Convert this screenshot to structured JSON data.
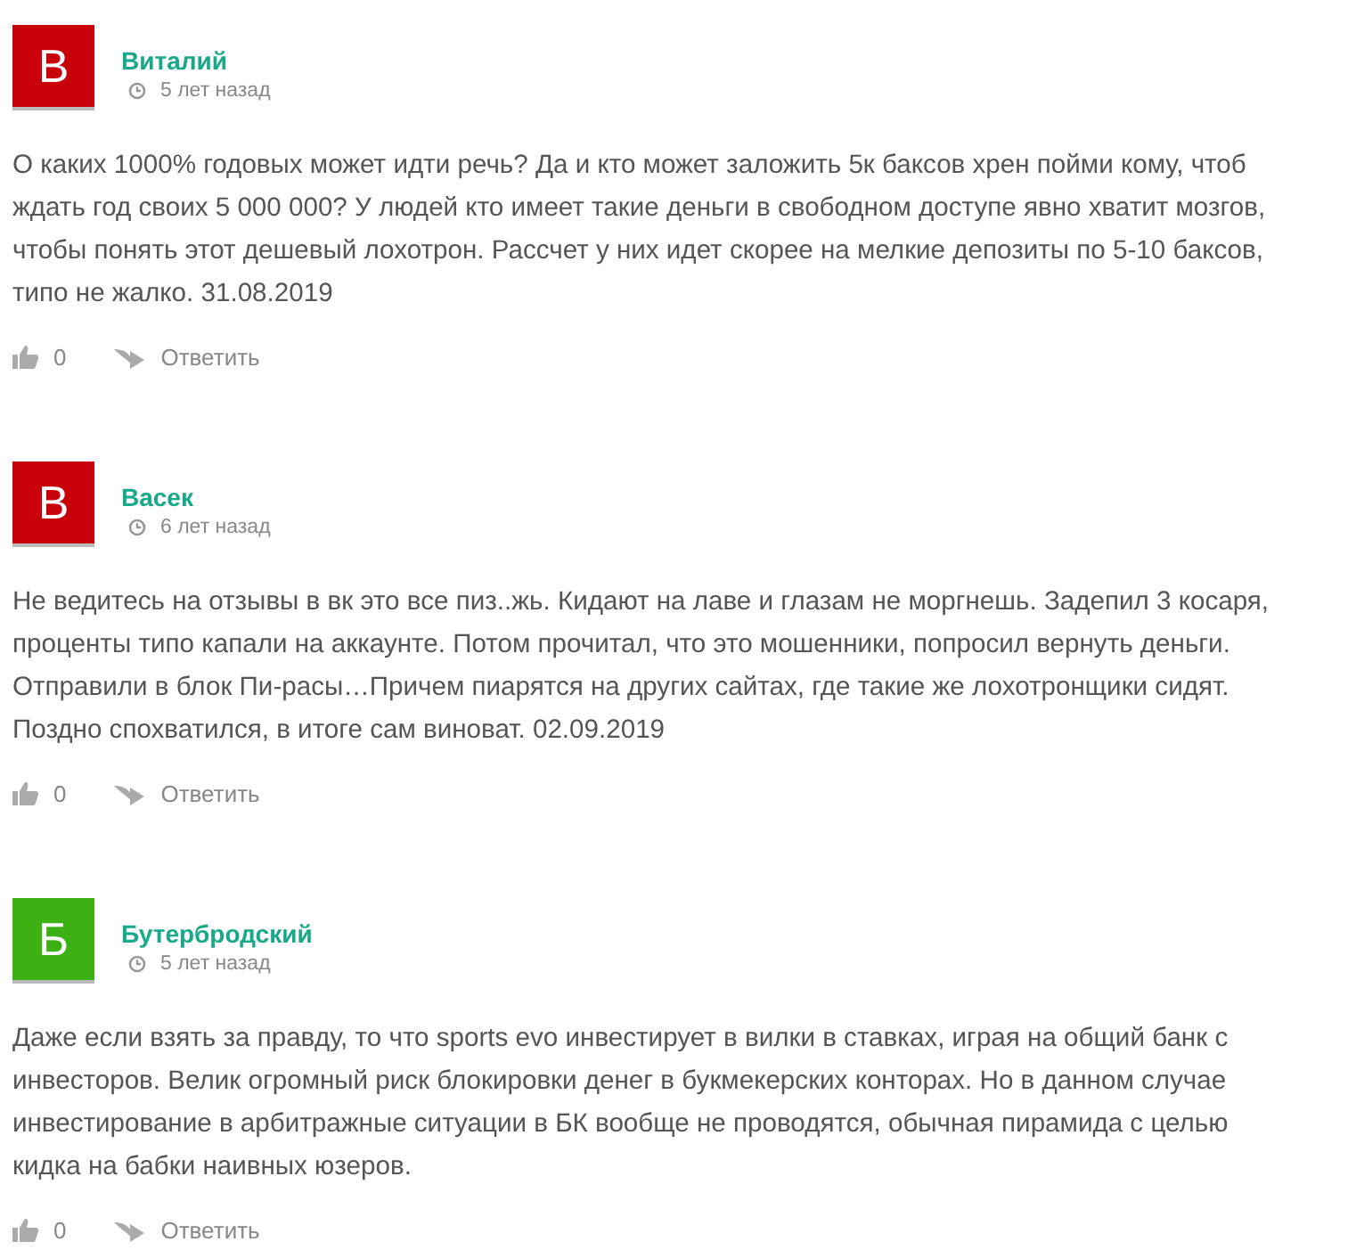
{
  "comments": [
    {
      "avatar_letter": "В",
      "color": "#c80009",
      "author": "Виталий",
      "time": "5 лет назад",
      "text": "О каких 1000% годовых может идти речь? Да и кто может заложить 5к баксов хрен пойми кому, чтоб ждать год своих 5 000 000? У людей кто имеет такие деньги в свободном доступе явно хватит мозгов, чтобы понять этот дешевый лохотрон. Рассчет у них идет скорее на мелкие депозиты по 5-10 баксов, типо не жалко. 31.08.2019",
      "likes": "0",
      "reply": "Ответить"
    },
    {
      "avatar_letter": "В",
      "color": "#c80009",
      "author": "Васек",
      "time": "6 лет назад",
      "text": "Не ведитесь на отзывы в вк это все пиз..жь. Кидают на лаве и глазам не моргнешь. Задепил 3 косаря, проценты типо капали на аккаунте. Потом прочитал, что это мошенники, попросил вернуть деньги. Отправили в блок Пи-расы…Причем пиарятся на других сайтах, где такие же лохотронщики сидят. Поздно спохватился, в итоге сам виноват. 02.09.2019",
      "likes": "0",
      "reply": "Ответить"
    },
    {
      "avatar_letter": "Б",
      "color": "#3db014",
      "author": "Бутербродский",
      "time": "5 лет назад",
      "text": "Даже если взять за правду, то что sports evo инвестирует в вилки в ставках, играя на общий банк с инвесторов. Велик огромный риск блокировки денег в букмекерских конторах. Но в данном случае инвестирование в арбитражные ситуации в БК вообще не проводятся, обычная пирамида с целью кидка на бабки наивных юзеров.",
      "likes": "0",
      "reply": "Ответить"
    }
  ]
}
